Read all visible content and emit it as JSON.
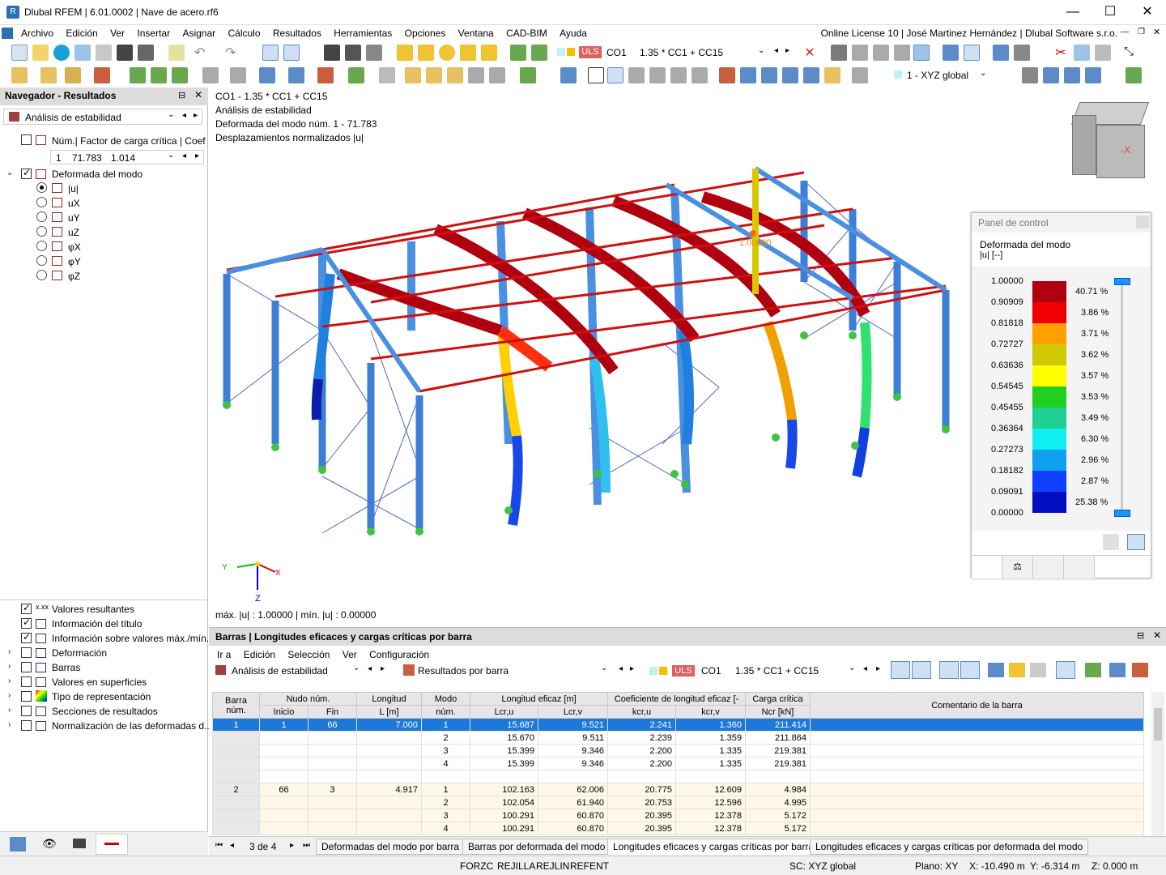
{
  "app": {
    "title": "Dlubal RFEM | 6.01.0002 | Nave de acero.rf6",
    "logo": "R"
  },
  "window_controls": {
    "minimize": "—",
    "maximize": "☐",
    "close": "✕"
  },
  "menu": {
    "items": [
      "Archivo",
      "Edición",
      "Ver",
      "Insertar",
      "Asignar",
      "Cálculo",
      "Resultados",
      "Herramientas",
      "Opciones",
      "Ventana",
      "CAD-BIM",
      "Ayuda"
    ],
    "license": "Online License 10 | José Martinez Hernández | Dlubal Software s.r.o."
  },
  "toolbar1": {
    "uls": "ULS",
    "combo": "CO1",
    "combo_desc": "1.35 * CC1 + CC15"
  },
  "toolbar2": {
    "coord_system": "1 - XYZ global"
  },
  "navigator": {
    "title": "Navegador - Resultados",
    "analysis": "Análisis de estabilidad",
    "mode_header": "Núm.| Factor de carga crítica | Coefi...",
    "mode_num": "1",
    "mode_factor": "71.783",
    "mode_coef": "1.014",
    "shape_label": "Deformada del modo",
    "components": [
      "|u|",
      "uX",
      "uY",
      "uZ",
      "φX",
      "φY",
      "φZ"
    ],
    "options": [
      "Valores resultantes",
      "Información del título",
      "Información sobre valores máx./mín.",
      "Deformación",
      "Barras",
      "Valores en superficies",
      "Tipo de representación",
      "Secciones de resultados",
      "Normalización de las deformadas d..."
    ]
  },
  "view": {
    "lines": [
      "CO1 - 1.35 * CC1 + CC15",
      "Análisis de estabilidad",
      "Deformada del modo núm. 1 - 71.783",
      "Desplazamientos normalizados |u|"
    ],
    "maxmin": "máx. |u| : 1.00000 | mín. |u| : 0.00000",
    "max_label": "1.00000",
    "axis": {
      "y": "Y",
      "x": "X",
      "z": "Z"
    },
    "cube_label": "-X"
  },
  "control_panel": {
    "title": "Panel de control",
    "subtitle": "Deformada del modo",
    "unit": "|u| [--]",
    "values": [
      "1.00000",
      "0.90909",
      "0.81818",
      "0.72727",
      "0.63636",
      "0.54545",
      "0.45455",
      "0.36364",
      "0.27273",
      "0.18182",
      "0.09091",
      "0.00000"
    ],
    "colors": [
      "#b00010",
      "#f00000",
      "#ffa000",
      "#d0c800",
      "#ffff00",
      "#20d020",
      "#20d090",
      "#10f0f0",
      "#10a0f0",
      "#1040ff",
      "#0010c0"
    ],
    "percents": [
      "40.71 %",
      "3.86 %",
      "3.71 %",
      "3.62 %",
      "3.57 %",
      "3.53 %",
      "3.49 %",
      "6.30 %",
      "2.96 %",
      "2.87 %",
      "25.38 %"
    ]
  },
  "bottom": {
    "title": "Barras | Longitudes eficaces y cargas críticas por barra",
    "menu": [
      "Ir a",
      "Edición",
      "Selección",
      "Ver",
      "Configuración"
    ],
    "analysis": "Análisis de estabilidad",
    "results_by": "Resultados por barra",
    "uls": "ULS",
    "combo": "CO1",
    "combo_desc": "1.35 * CC1 + CC15",
    "headers": {
      "bar": "Barra",
      "bar2": "núm.",
      "node": "Nudo núm.",
      "start": "Inicio",
      "end": "Fin",
      "length": "Longitud",
      "length2": "L [m]",
      "mode": "Modo",
      "mode2": "núm.",
      "leff": "Longitud eficaz [m]",
      "lcru": "Lcr,u",
      "lcrv": "Lcr,v",
      "k": "Coeficiente de longitud eficaz [-",
      "kcru": "kcr,u",
      "kcrv": "kcr,v",
      "ncr": "Carga crítica",
      "ncr2": "Ncr [kN]",
      "comment": "Comentario de la barra"
    },
    "rows": [
      {
        "bar": "1",
        "start": "1",
        "end": "66",
        "len": "7.000",
        "mode": "1",
        "lu": "15.687",
        "lv": "9.521",
        "ku": "2.241",
        "kv": "1.360",
        "n": "211.414",
        "sel": true
      },
      {
        "bar": "",
        "start": "",
        "end": "",
        "len": "",
        "mode": "2",
        "lu": "15.670",
        "lv": "9.511",
        "ku": "2.239",
        "kv": "1.359",
        "n": "211.864"
      },
      {
        "bar": "",
        "start": "",
        "end": "",
        "len": "",
        "mode": "3",
        "lu": "15.399",
        "lv": "9.346",
        "ku": "2.200",
        "kv": "1.335",
        "n": "219.381"
      },
      {
        "bar": "",
        "start": "",
        "end": "",
        "len": "",
        "mode": "4",
        "lu": "15.399",
        "lv": "9.346",
        "ku": "2.200",
        "kv": "1.335",
        "n": "219.381"
      },
      {
        "bar": "",
        "start": "",
        "end": "",
        "len": "",
        "mode": "",
        "lu": "",
        "lv": "",
        "ku": "",
        "kv": "",
        "n": ""
      },
      {
        "bar": "2",
        "start": "66",
        "end": "3",
        "len": "4.917",
        "mode": "1",
        "lu": "102.163",
        "lv": "62.006",
        "ku": "20.775",
        "kv": "12.609",
        "n": "4.984"
      },
      {
        "bar": "",
        "start": "",
        "end": "",
        "len": "",
        "mode": "2",
        "lu": "102.054",
        "lv": "61.940",
        "ku": "20.753",
        "kv": "12.596",
        "n": "4.995"
      },
      {
        "bar": "",
        "start": "",
        "end": "",
        "len": "",
        "mode": "3",
        "lu": "100.291",
        "lv": "60.870",
        "ku": "20.395",
        "kv": "12.378",
        "n": "5.172"
      },
      {
        "bar": "",
        "start": "",
        "end": "",
        "len": "",
        "mode": "4",
        "lu": "100.291",
        "lv": "60.870",
        "ku": "20.395",
        "kv": "12.378",
        "n": "5.172"
      }
    ],
    "pager": "3 de 4",
    "tabs": [
      "Deformadas del modo por barra",
      "Barras por deformada del modo",
      "Longitudes eficaces y cargas críticas por barra",
      "Longitudes eficaces y cargas críticas por deformada del modo"
    ]
  },
  "status": {
    "items": [
      "FORZC",
      "REJILLA",
      "REJLIN",
      "REFENT"
    ],
    "cs": "SC: XYZ global",
    "plane": "Plano: XY",
    "x": "X: -10.490 m",
    "y": "Y: -6.314 m",
    "z": "Z: 0.000 m"
  }
}
